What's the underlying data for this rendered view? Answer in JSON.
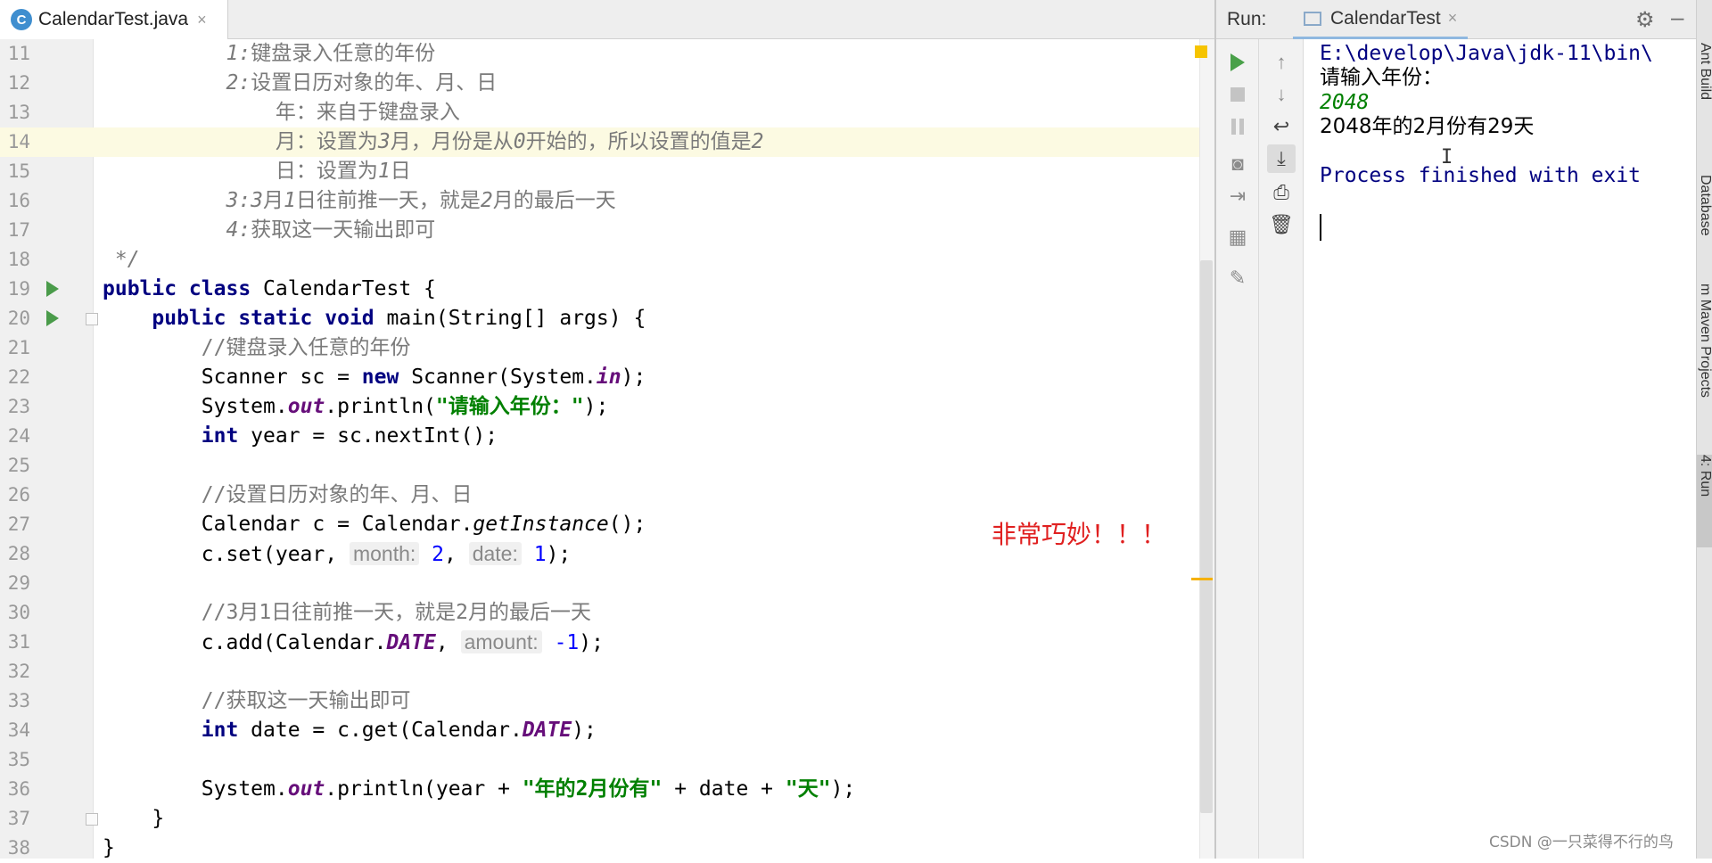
{
  "editor": {
    "tab": {
      "icon": "C",
      "label": "CalendarTest.java",
      "close": "×"
    },
    "current_line": 14
  },
  "code_lines": [
    {
      "no": "11",
      "seg": [
        [
          "cmt-plain",
          "          "
        ],
        [
          "cmt",
          "1:"
        ],
        [
          "cmt-plain",
          "键盘录入任意的年份"
        ]
      ]
    },
    {
      "no": "12",
      "seg": [
        [
          "cmt-plain",
          "          "
        ],
        [
          "cmt",
          "2:"
        ],
        [
          "cmt-plain",
          "设置日历对象的年、月、日"
        ]
      ]
    },
    {
      "no": "13",
      "seg": [
        [
          "cmt-plain",
          "              年：来自于键盘录入"
        ]
      ]
    },
    {
      "no": "14",
      "seg": [
        [
          "cmt-plain",
          "              月：设置为"
        ],
        [
          "cmt",
          "3"
        ],
        [
          "cmt-plain",
          "月，月份是从"
        ],
        [
          "cmt",
          "0"
        ],
        [
          "cmt-plain",
          "开始的，所以设置的值是"
        ],
        [
          "cmt",
          "2"
        ]
      ]
    },
    {
      "no": "15",
      "seg": [
        [
          "cmt-plain",
          "              日：设置为"
        ],
        [
          "cmt",
          "1"
        ],
        [
          "cmt-plain",
          "日"
        ]
      ]
    },
    {
      "no": "16",
      "seg": [
        [
          "cmt-plain",
          "          "
        ],
        [
          "cmt",
          "3:3"
        ],
        [
          "cmt-plain",
          "月"
        ],
        [
          "cmt",
          "1"
        ],
        [
          "cmt-plain",
          "日往前推一天，就是"
        ],
        [
          "cmt",
          "2"
        ],
        [
          "cmt-plain",
          "月的最后一天"
        ]
      ]
    },
    {
      "no": "17",
      "seg": [
        [
          "cmt-plain",
          "          "
        ],
        [
          "cmt",
          "4:"
        ],
        [
          "cmt-plain",
          "获取这一天输出即可"
        ]
      ]
    },
    {
      "no": "18",
      "seg": [
        [
          "cmt",
          " */"
        ]
      ]
    },
    {
      "no": "19",
      "run": true,
      "seg": [
        [
          "kw",
          "public class "
        ],
        [
          "",
          "CalendarTest {"
        ]
      ]
    },
    {
      "no": "20",
      "run": true,
      "fold": true,
      "seg": [
        [
          "",
          "    "
        ],
        [
          "kw",
          "public static void "
        ],
        [
          "",
          "main(String[] args) {"
        ]
      ]
    },
    {
      "no": "21",
      "seg": [
        [
          "",
          "        "
        ],
        [
          "cmt-plain",
          "//键盘录入任意的年份"
        ]
      ]
    },
    {
      "no": "22",
      "seg": [
        [
          "",
          "        Scanner sc = "
        ],
        [
          "kw",
          "new "
        ],
        [
          "",
          "Scanner(System."
        ],
        [
          "fld",
          "in"
        ],
        [
          "",
          ");"
        ]
      ]
    },
    {
      "no": "23",
      "seg": [
        [
          "",
          "        System."
        ],
        [
          "fld",
          "out"
        ],
        [
          "",
          ".println("
        ],
        [
          "str",
          "\"请输入年份：\""
        ],
        [
          "",
          ");"
        ]
      ]
    },
    {
      "no": "24",
      "seg": [
        [
          "",
          "        "
        ],
        [
          "kw",
          "int "
        ],
        [
          "",
          "year = sc.nextInt();"
        ]
      ]
    },
    {
      "no": "25",
      "seg": []
    },
    {
      "no": "26",
      "seg": [
        [
          "",
          "        "
        ],
        [
          "cmt-plain",
          "//设置日历对象的年、月、日"
        ]
      ]
    },
    {
      "no": "27",
      "seg": [
        [
          "",
          "        Calendar c = Calendar."
        ],
        [
          "ital",
          "getInstance"
        ],
        [
          "",
          "();"
        ]
      ]
    },
    {
      "no": "28",
      "seg": [
        [
          "",
          "        c.set(year, "
        ],
        [
          "hint",
          "month:"
        ],
        [
          "",
          " "
        ],
        [
          "num",
          "2"
        ],
        [
          "",
          ", "
        ],
        [
          "hint",
          "date:"
        ],
        [
          "",
          " "
        ],
        [
          "num",
          "1"
        ],
        [
          "",
          ");"
        ]
      ]
    },
    {
      "no": "29",
      "seg": []
    },
    {
      "no": "30",
      "seg": [
        [
          "",
          "        "
        ],
        [
          "cmt-plain",
          "//3月1日往前推一天，就是2月的最后一天"
        ]
      ]
    },
    {
      "no": "31",
      "seg": [
        [
          "",
          "        c.add(Calendar."
        ],
        [
          "fld",
          "DATE"
        ],
        [
          "",
          ", "
        ],
        [
          "hint",
          "amount:"
        ],
        [
          "",
          " "
        ],
        [
          "num",
          "-1"
        ],
        [
          "",
          ");"
        ]
      ]
    },
    {
      "no": "32",
      "seg": []
    },
    {
      "no": "33",
      "seg": [
        [
          "",
          "        "
        ],
        [
          "cmt-plain",
          "//获取这一天输出即可"
        ]
      ]
    },
    {
      "no": "34",
      "seg": [
        [
          "",
          "        "
        ],
        [
          "kw",
          "int "
        ],
        [
          "",
          "date = c.get(Calendar."
        ],
        [
          "fld",
          "DATE"
        ],
        [
          "",
          ");"
        ]
      ]
    },
    {
      "no": "35",
      "seg": []
    },
    {
      "no": "36",
      "seg": [
        [
          "",
          "        System."
        ],
        [
          "fld",
          "out"
        ],
        [
          "",
          ".println(year + "
        ],
        [
          "str",
          "\"年的2月份有\""
        ],
        [
          "",
          " + date + "
        ],
        [
          "str",
          "\"天\""
        ],
        [
          "",
          ");"
        ]
      ]
    },
    {
      "no": "37",
      "fold": true,
      "seg": [
        [
          "",
          "    }"
        ]
      ]
    },
    {
      "no": "38",
      "seg": [
        [
          "",
          "}"
        ]
      ]
    }
  ],
  "annotation": {
    "text": "非常巧妙！！！",
    "color": "#e02020"
  },
  "run_panel": {
    "title": "Run:",
    "tab_label": "CalendarTest",
    "tab_close": "×",
    "toolbar_left": [
      "run-icon",
      "stop-icon",
      "pause-icon",
      "camera-icon",
      "login-icon",
      "layout-icon",
      "pin-icon"
    ],
    "toolbar_right": [
      "up-arrow-icon",
      "down-arrow-icon",
      "soft-wrap-icon",
      "scroll-to-end-icon",
      "print-icon",
      "trash-icon"
    ],
    "console": {
      "path_line": "E:\\develop\\Java\\jdk-11\\bin\\",
      "prompt_line": "请输入年份：",
      "input_line": "2048",
      "result_line": "2048年的2月份有29天",
      "finished_line": "Process finished with exit"
    }
  },
  "side_stripe": [
    "Ant Build",
    "Database",
    "m Maven Projects",
    "4: Run"
  ],
  "watermark": "CSDN @一只菜得不行的鸟",
  "colors": {
    "keyword": "#000080",
    "string": "#008000",
    "number": "#0000ff",
    "field": "#660e7a",
    "comment": "#7a7a7a",
    "current_line": "#fcfae2"
  }
}
